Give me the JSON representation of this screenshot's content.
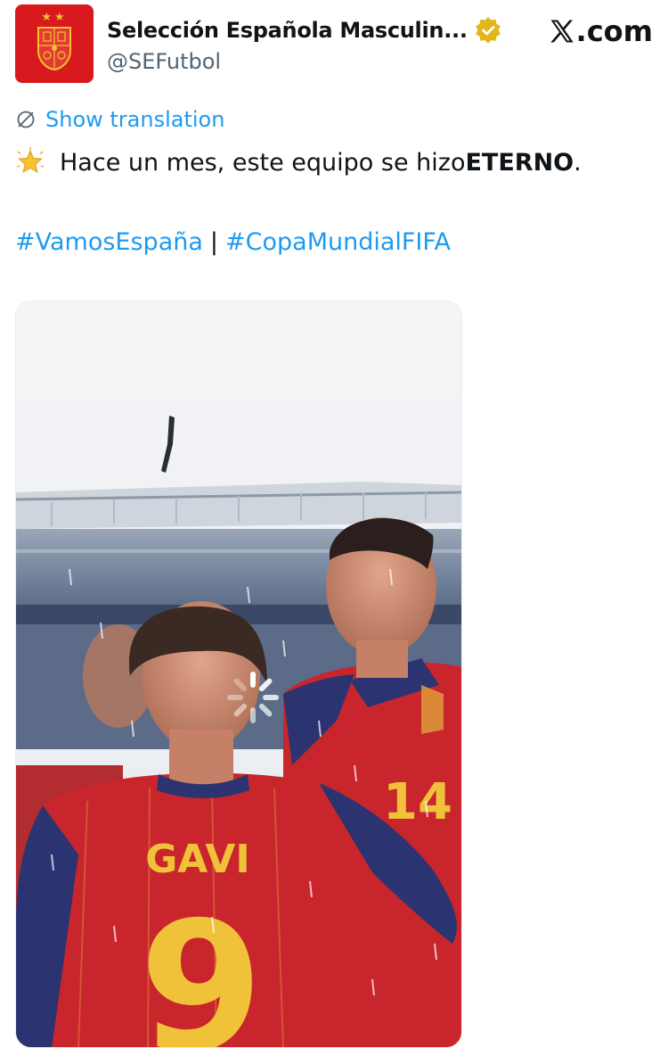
{
  "author": {
    "display_name": "Selección Española Masculin...",
    "handle": "@SEFutbol",
    "verified_badge": "gold-verified-badge",
    "avatar": {
      "description": "red-crest-avatar",
      "color": "#d81a1f",
      "stars": "★★"
    }
  },
  "platform": {
    "logo_text": ".com",
    "logo_icon": "x-logo-icon"
  },
  "translation": {
    "label": "Show translation",
    "icon": "globe-slash-icon"
  },
  "tweet": {
    "emoji": "glowing-star-emoji",
    "text_before": "Hace un mes, este equipo se hizo ",
    "text_bold": "ETERNO",
    "text_after": "."
  },
  "hashtags": {
    "first": "#VamosEspaña",
    "separator": "|",
    "second": "#CopaMundialFIFA"
  },
  "media": {
    "type": "video",
    "state": "loading",
    "shirt_name": "GAVI",
    "shirt_number": "9",
    "second_player_number": "14"
  },
  "colors": {
    "link": "#1d9bf0",
    "text": "#0f1419",
    "muted": "#536471",
    "jersey_red": "#c8262c",
    "jersey_gold": "#f0c23a",
    "jersey_navy": "#2b3470"
  }
}
